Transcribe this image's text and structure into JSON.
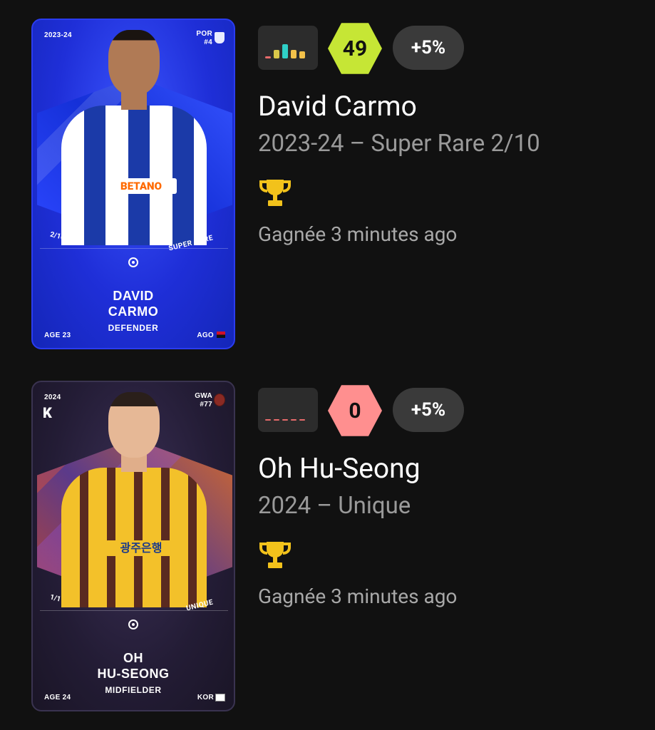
{
  "items": [
    {
      "card": {
        "season": "2023-24",
        "club_line1": "POR",
        "club_line2": "#4",
        "serial": "2/10",
        "rarity": "SUPER RARE",
        "name_line1": "DAVID",
        "name_line2": "CARMO",
        "position": "DEFENDER",
        "age": "AGE 23",
        "nationality": "AGO",
        "sponsor": "BETANO",
        "theme": "blue"
      },
      "form_bars_colors": [
        "#e76b6b",
        "#d9c84a",
        "#2fd0c8",
        "#f2c14a",
        "#f2c14a"
      ],
      "form_bars_heights": [
        0.15,
        0.55,
        0.9,
        0.55,
        0.45
      ],
      "score": "49",
      "score_color": "#c6e635",
      "bonus": "+5%",
      "player_name": "David Carmo",
      "subtitle": "2023-24 – Super Rare 2/10",
      "trophy_icon": "trophy-icon",
      "won_text": "Gagnée 3 minutes ago"
    },
    {
      "card": {
        "season": "2024",
        "club_line1": "GWA",
        "club_line2": "#77",
        "serial": "1/1",
        "rarity": "UNIQUE",
        "name_line1": "OH",
        "name_line2": "HU-SEONG",
        "position": "MIDFIELDER",
        "age": "AGE 24",
        "nationality": "KOR",
        "sponsor": "광주은행",
        "league": "K",
        "theme": "dark"
      },
      "form_bars_colors": [
        "#e76b6b",
        "#e76b6b",
        "#e76b6b",
        "#e76b6b",
        "#e76b6b"
      ],
      "form_bars_heights": [
        0.05,
        0.05,
        0.05,
        0.05,
        0.05
      ],
      "score": "0",
      "score_color": "#ff8f8f",
      "bonus": "+5%",
      "player_name": "Oh Hu-Seong",
      "subtitle": "2024 – Unique",
      "trophy_icon": "trophy-icon",
      "won_text": "Gagnée 3 minutes ago"
    }
  ],
  "colors": {
    "background": "#111111",
    "trophy": "#f2c21b"
  }
}
